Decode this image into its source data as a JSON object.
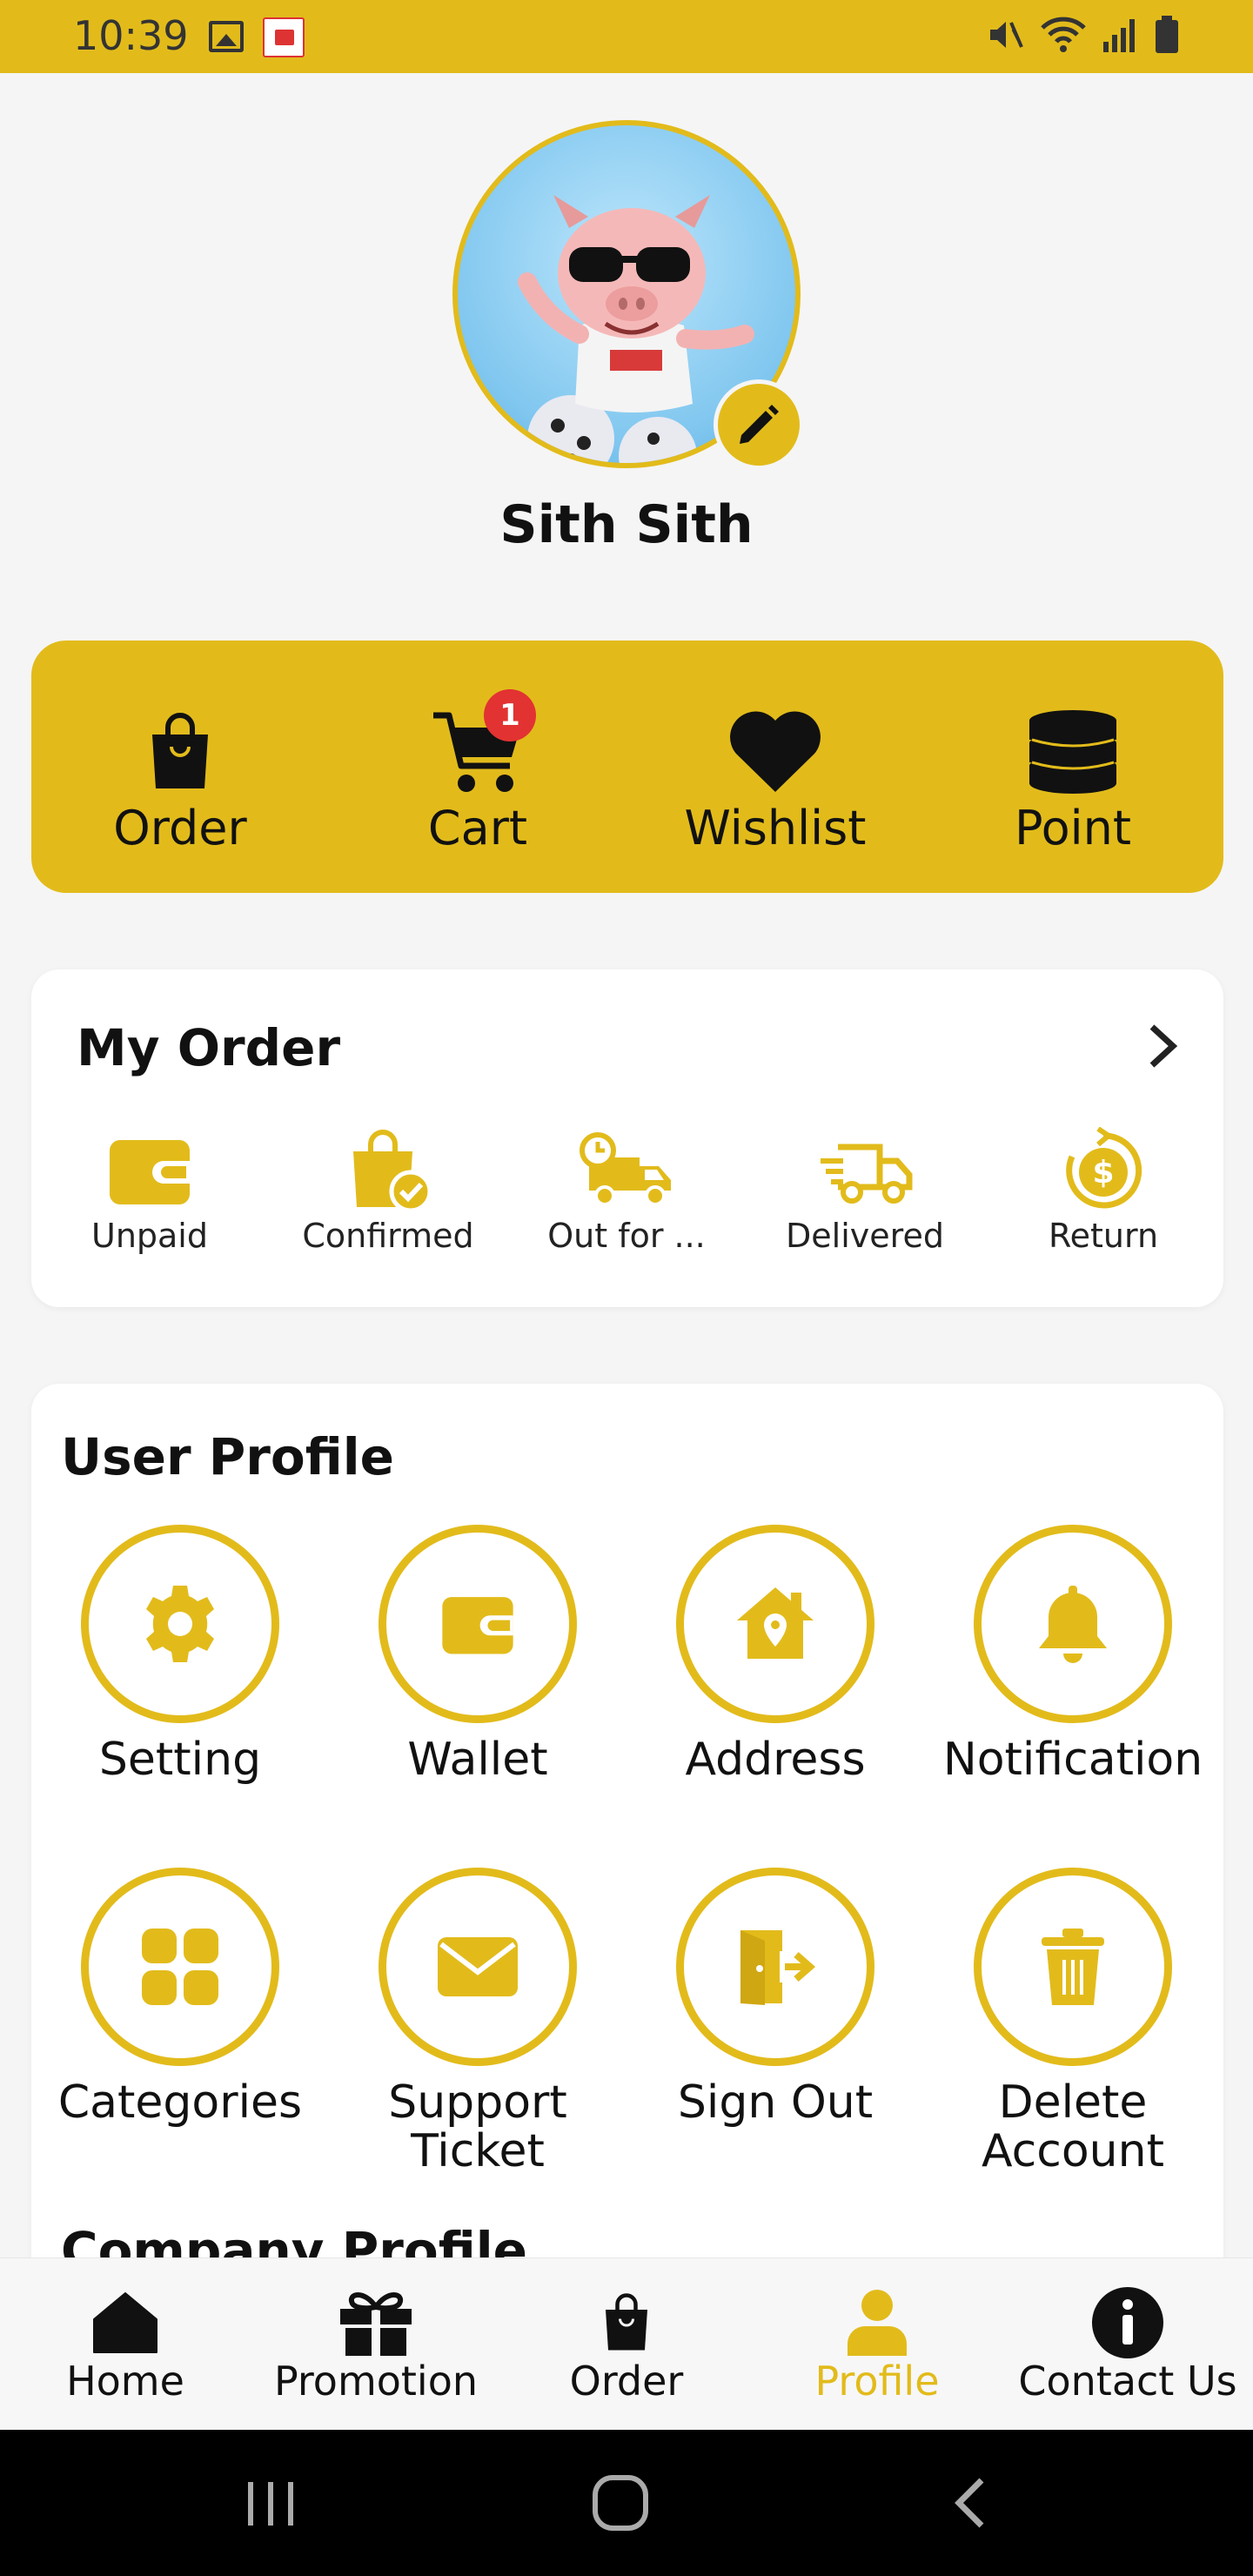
{
  "status_bar": {
    "time": "10:39"
  },
  "profile": {
    "name": "Sith Sith"
  },
  "quick_actions": [
    {
      "label": "Order",
      "icon": "shopping-bag-icon"
    },
    {
      "label": "Cart",
      "icon": "cart-icon",
      "badge": "1"
    },
    {
      "label": "Wishlist",
      "icon": "heart-icon"
    },
    {
      "label": "Point",
      "icon": "coins-icon"
    }
  ],
  "my_order": {
    "title": "My Order",
    "statuses": [
      {
        "label": "Unpaid",
        "icon": "wallet-icon"
      },
      {
        "label": "Confirmed",
        "icon": "bag-check-icon"
      },
      {
        "label": "Out for ...",
        "icon": "delivery-truck-clock-icon"
      },
      {
        "label": "Delivered",
        "icon": "fast-truck-icon"
      },
      {
        "label": "Return",
        "icon": "dollar-refresh-icon"
      }
    ]
  },
  "user_profile": {
    "title": "User Profile",
    "items": [
      {
        "label": "Setting",
        "icon": "gear-icon"
      },
      {
        "label": "Wallet",
        "icon": "wallet-icon"
      },
      {
        "label": "Address",
        "icon": "home-location-icon"
      },
      {
        "label": "Notification",
        "icon": "bell-icon"
      },
      {
        "label": "Categories",
        "icon": "grid-icon"
      },
      {
        "label": "Support Ticket",
        "icon": "envelope-icon"
      },
      {
        "label": "Sign Out",
        "icon": "sign-out-icon"
      },
      {
        "label": "Delete Account",
        "icon": "trash-icon"
      }
    ]
  },
  "company_profile": {
    "title": "Company Profile"
  },
  "bottom_nav": [
    {
      "label": "Home",
      "icon": "home-icon",
      "active": false
    },
    {
      "label": "Promotion",
      "icon": "gift-icon",
      "active": false
    },
    {
      "label": "Order",
      "icon": "shopping-bag-icon",
      "active": false
    },
    {
      "label": "Profile",
      "icon": "user-icon",
      "active": true
    },
    {
      "label": "Contact Us",
      "icon": "info-icon",
      "active": false
    }
  ],
  "colors": {
    "accent": "#e2bb1b",
    "badge": "#e23232",
    "background": "#f5f5f5"
  }
}
